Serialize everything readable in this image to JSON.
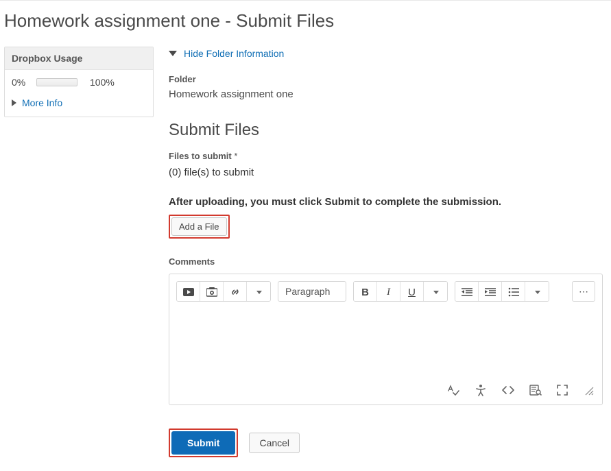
{
  "page_title": "Homework assignment one - Submit Files",
  "sidebar": {
    "dropbox_usage_heading": "Dropbox Usage",
    "usage_current": "0%",
    "usage_max": "100%",
    "more_info_label": "More Info"
  },
  "folder_info": {
    "toggle_label": "Hide Folder Information",
    "folder_label": "Folder",
    "folder_name": "Homework assignment one"
  },
  "submit": {
    "section_title": "Submit Files",
    "files_to_submit_label": "Files to submit",
    "files_count_text": "(0) file(s) to submit",
    "upload_instruction": "After uploading, you must click Submit to complete the submission.",
    "add_file_label": "Add a File"
  },
  "comments": {
    "label": "Comments",
    "paragraph_dropdown": "Paragraph",
    "more_menu": "⋯"
  },
  "actions": {
    "submit_label": "Submit",
    "cancel_label": "Cancel"
  }
}
